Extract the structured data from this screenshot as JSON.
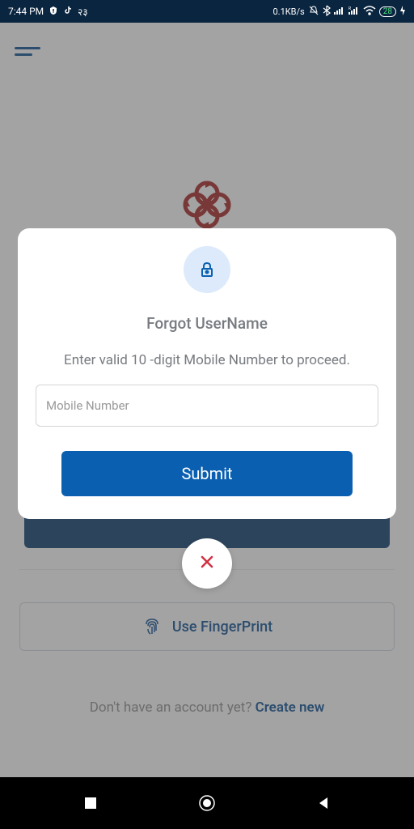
{
  "status": {
    "time": "7:44 PM",
    "dataRate": "0.1KB/s",
    "battery": "28",
    "marathi": "२३"
  },
  "background": {
    "fingerprintLabel": "Use FingerPrint",
    "signupPrompt": "Don't have an account yet?",
    "signupLink": "Create new"
  },
  "modal": {
    "title": "Forgot UserName",
    "description": "Enter valid 10 -digit Mobile Number to proceed.",
    "placeholder": "Mobile Number",
    "submitLabel": "Submit"
  }
}
